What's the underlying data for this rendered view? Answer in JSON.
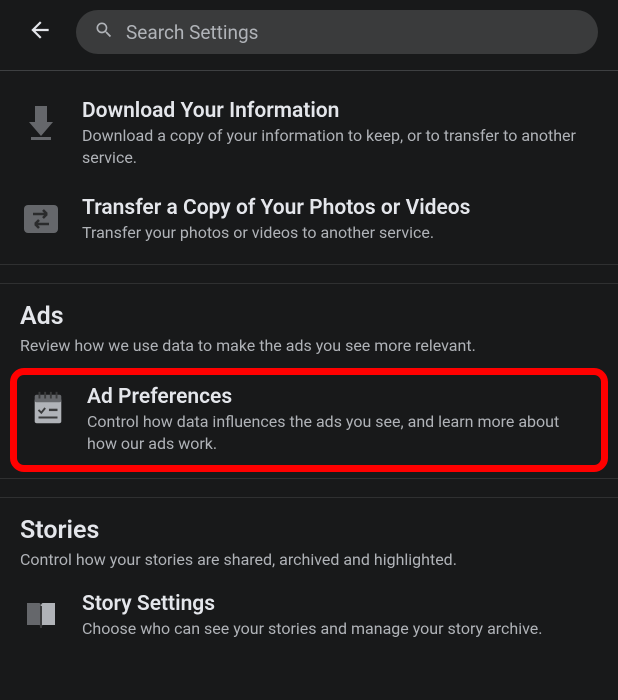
{
  "search": {
    "placeholder": "Search Settings"
  },
  "items": {
    "download": {
      "title": "Download Your Information",
      "description": "Download a copy of your information to keep, or to transfer to another service."
    },
    "transfer": {
      "title": "Transfer a Copy of Your Photos or Videos",
      "description": "Transfer your photos or videos to another service."
    },
    "adPrefs": {
      "title": "Ad Preferences",
      "description": "Control how data influences the ads you see, and learn more about how our ads work."
    },
    "storySettings": {
      "title": "Story Settings",
      "description": "Choose who can see your stories and manage your story archive."
    }
  },
  "sections": {
    "ads": {
      "title": "Ads",
      "description": "Review how we use data to make the ads you see more relevant."
    },
    "stories": {
      "title": "Stories",
      "description": "Control how your stories are shared, archived and highlighted."
    }
  }
}
